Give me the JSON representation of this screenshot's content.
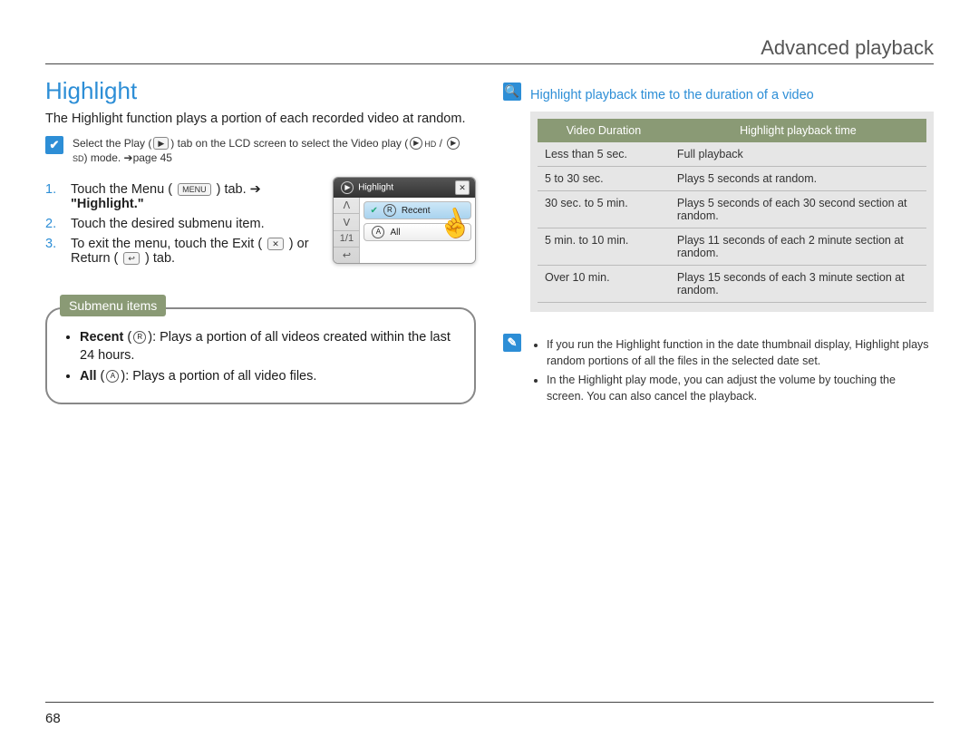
{
  "header": {
    "title": "Advanced playback"
  },
  "page_number": "68",
  "left": {
    "heading": "Highlight",
    "intro": "The Highlight function plays a portion of each recorded video at random.",
    "select_note": {
      "pre": "Select the Play (",
      "mid1": ") tab on the LCD screen to select the Video play (",
      "mid2": " / ",
      "post": ") mode. ➔page 45",
      "play_icon": "▶",
      "hd_icon": "HD",
      "sd_icon": "SD"
    },
    "steps": [
      {
        "num": "1.",
        "pre": "Touch the Menu ( ",
        "icon": "MENU",
        "mid": " ) tab. ➔ ",
        "bold": "\"Highlight.\""
      },
      {
        "num": "2.",
        "text": "Touch the desired submenu item."
      },
      {
        "num": "3.",
        "pre": "To exit the menu, touch the Exit ( ",
        "icon1": "✕",
        "mid": " ) or Return ( ",
        "icon2": "↩",
        "post": " ) tab."
      }
    ],
    "screenshot": {
      "title": "Highlight",
      "close": "✕",
      "items": [
        {
          "check": "✔",
          "badge": "R",
          "label": "Recent",
          "selected": true
        },
        {
          "check": "",
          "badge": "A",
          "label": "All",
          "selected": false
        }
      ],
      "side": [
        "ᐱ",
        "ᐯ",
        "1/1",
        "↩"
      ]
    },
    "submenu": {
      "tab_label": "Submenu items",
      "items": [
        {
          "bold": "Recent",
          "badge": "R",
          "text": ": Plays a portion of all videos created within the last 24 hours."
        },
        {
          "bold": "All",
          "badge": "A",
          "text": ": Plays a portion of all video files."
        }
      ]
    }
  },
  "right": {
    "subtitle": "Highlight playback time to the duration of a video",
    "table": {
      "headers": [
        "Video Duration",
        "Highlight playback time"
      ],
      "rows": [
        [
          "Less than 5 sec.",
          "Full playback"
        ],
        [
          "5 to 30 sec.",
          "Plays 5 seconds at random."
        ],
        [
          "30 sec. to 5 min.",
          "Plays 5 seconds of each 30 second section at random."
        ],
        [
          "5 min. to 10 min.",
          "Plays 11 seconds of each 2 minute section at random."
        ],
        [
          "Over 10 min.",
          "Plays 15 seconds of each 3 minute section at random."
        ]
      ]
    },
    "notes": [
      "If you run the Highlight function in the date thumbnail display, Highlight plays random portions of all the files in the selected date set.",
      "In the Highlight play mode, you can adjust the volume by touching the screen. You can also cancel the playback."
    ]
  }
}
